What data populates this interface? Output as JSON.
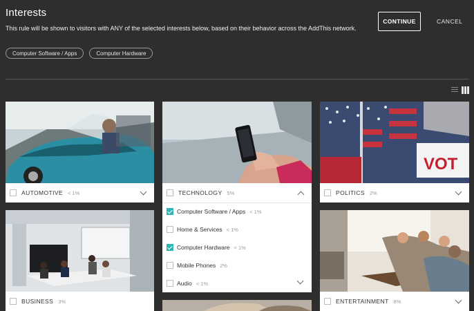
{
  "header": {
    "title": "Interests",
    "subtitle": "This rule will be shown to visitors with ANY of the selected interests below, based on their behavior across the AddThis network.",
    "continue_label": "CONTINUE",
    "cancel_label": "CANCEL"
  },
  "selected_chips": [
    "Computer Software / Apps",
    "Computer Hardware"
  ],
  "categories": {
    "automotive": {
      "name": "AUTOMOTIVE",
      "pct": "< 1%",
      "checked": false
    },
    "technology": {
      "name": "TECHNOLOGY",
      "pct": "5%",
      "checked": false,
      "expanded": true,
      "subitems": [
        {
          "label": "Computer Software / Apps",
          "pct": "< 1%",
          "checked": true
        },
        {
          "label": "Home & Services",
          "pct": "< 1%",
          "checked": false
        },
        {
          "label": "Computer Hardware",
          "pct": "< 1%",
          "checked": true
        },
        {
          "label": "Mobile Phones",
          "pct": "2%",
          "checked": false
        },
        {
          "label": "Audio",
          "pct": "< 1%",
          "checked": false
        }
      ]
    },
    "politics": {
      "name": "POLITICS",
      "pct": "2%",
      "checked": false
    },
    "business": {
      "name": "BUSINESS",
      "pct": "3%",
      "checked": false
    },
    "entertainment": {
      "name": "ENTERTAINMENT",
      "pct": "8%",
      "checked": false
    }
  },
  "colors": {
    "background": "#2e2e2e",
    "accent": "#2bb5b5",
    "card": "#ffffff"
  },
  "icons": {
    "list_view": "list-view-icon",
    "grid_view": "grid-view-icon",
    "expand": "chevron-down-icon",
    "collapse": "chevron-up-icon"
  }
}
